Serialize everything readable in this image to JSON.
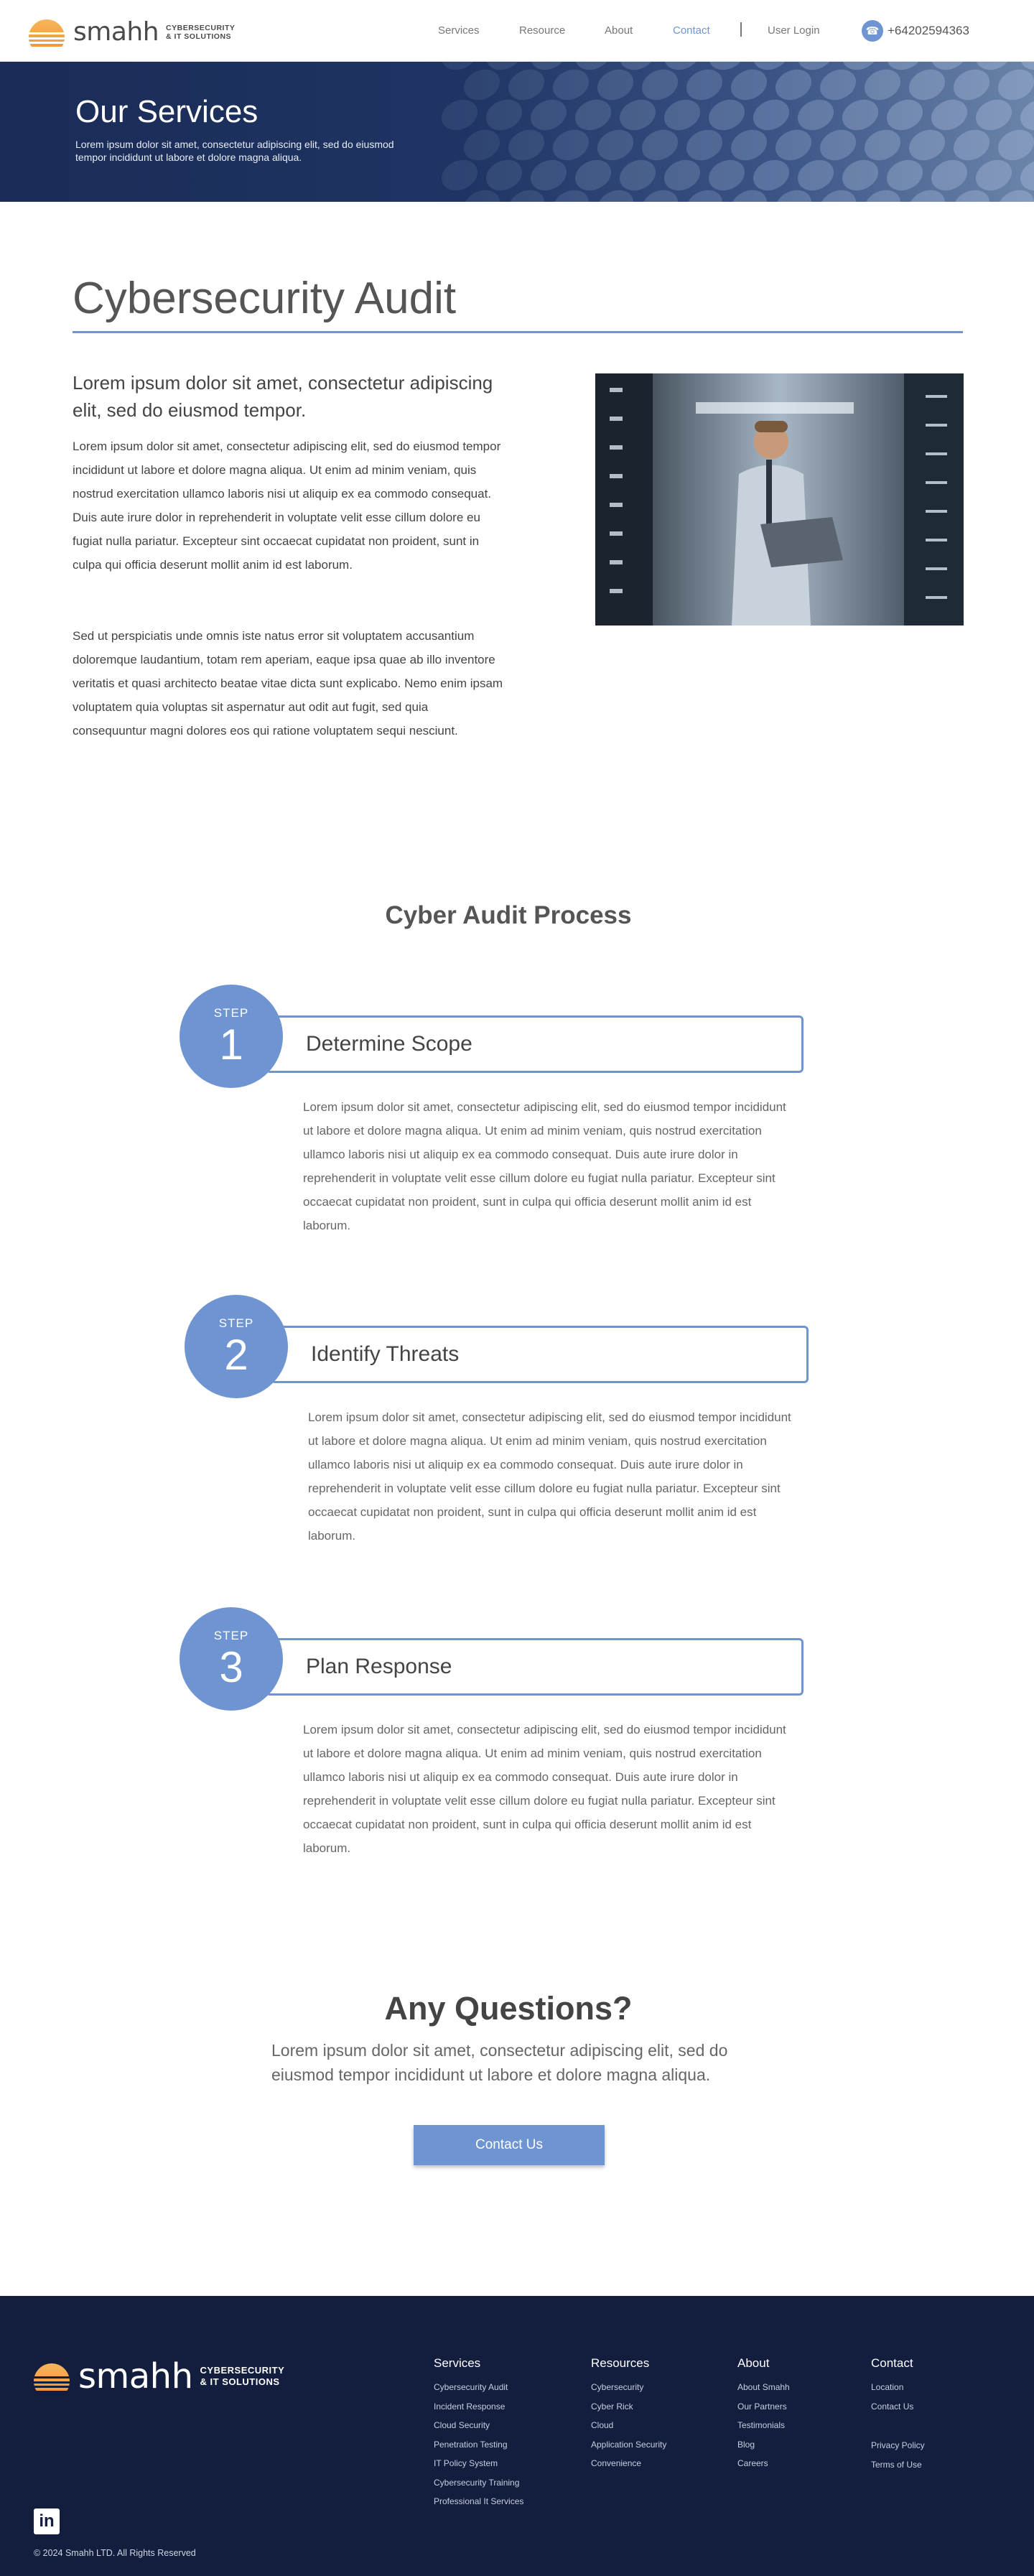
{
  "brand": {
    "name": "smahh",
    "tagline_1": "CYBERSECURITY",
    "tagline_2": "& IT SOLUTIONS"
  },
  "nav": {
    "links": [
      "Services",
      "Resource",
      "About",
      "Contact"
    ],
    "active": "Contact",
    "login": "User Login",
    "phone": "+64202594363"
  },
  "hero": {
    "title": "Our Services",
    "subtitle": "Lorem ipsum dolor sit amet, consectetur adipiscing elit, sed do eiusmod tempor incididunt ut labore et dolore magna aliqua."
  },
  "audit": {
    "title": "Cybersecurity Audit",
    "lead": "Lorem ipsum dolor sit amet, consectetur adipiscing elit, sed do eiusmod tempor.",
    "para1": "Lorem ipsum dolor sit amet, consectetur adipiscing elit, sed do eiusmod tempor incididunt ut labore et dolore magna aliqua. Ut enim ad minim veniam, quis nostrud exercitation ullamco laboris nisi ut aliquip ex ea commodo consequat. Duis aute irure dolor in reprehenderit in voluptate velit esse cillum dolore eu fugiat nulla pariatur. Excepteur sint occaecat cupidatat non proident, sunt in culpa qui officia deserunt mollit anim id est laborum.",
    "para2": "Sed ut perspiciatis unde omnis iste natus error sit voluptatem accusantium doloremque laudantium, totam rem aperiam, eaque ipsa quae ab illo inventore veritatis et quasi architecto beatae vitae dicta sunt explicabo. Nemo enim ipsam voluptatem quia voluptas sit aspernatur aut odit aut fugit, sed quia consequuntur magni dolores eos qui ratione voluptatem sequi nesciunt."
  },
  "process": {
    "title": "Cyber Audit Process",
    "step_label": "STEP",
    "steps": [
      {
        "number": "1",
        "name": "Determine Scope",
        "text": "Lorem ipsum dolor sit amet, consectetur adipiscing elit, sed do eiusmod tempor incididunt ut labore et dolore magna aliqua. Ut enim ad minim veniam, quis nostrud exercitation ullamco laboris nisi ut aliquip ex ea commodo consequat. Duis aute irure dolor in reprehenderit in voluptate velit esse cillum dolore eu fugiat nulla pariatur. Excepteur sint occaecat cupidatat non proident, sunt in culpa qui officia deserunt mollit anim id est laborum."
      },
      {
        "number": "2",
        "name": "Identify Threats",
        "text": "Lorem ipsum dolor sit amet, consectetur adipiscing elit, sed do eiusmod tempor incididunt ut labore et dolore magna aliqua. Ut enim ad minim veniam, quis nostrud exercitation ullamco laboris nisi ut aliquip ex ea commodo consequat. Duis aute irure dolor in reprehenderit in voluptate velit esse cillum dolore eu fugiat nulla pariatur. Excepteur sint occaecat cupidatat non proident, sunt in culpa qui officia deserunt mollit anim id est laborum."
      },
      {
        "number": "3",
        "name": "Plan Response",
        "text": "Lorem ipsum dolor sit amet, consectetur adipiscing elit, sed do eiusmod tempor incididunt ut labore et dolore magna aliqua. Ut enim ad minim veniam, quis nostrud exercitation ullamco laboris nisi ut aliquip ex ea commodo consequat. Duis aute irure dolor in reprehenderit in voluptate velit esse cillum dolore eu fugiat nulla pariatur. Excepteur sint occaecat cupidatat non proident, sunt in culpa qui officia deserunt mollit anim id est laborum."
      }
    ]
  },
  "questions": {
    "title": "Any Questions?",
    "text": "Lorem ipsum dolor sit amet, consectetur adipiscing elit, sed do eiusmod tempor incididunt ut labore et dolore magna aliqua.",
    "button": "Contact Us"
  },
  "footer": {
    "columns": [
      {
        "title": "Services",
        "items": [
          "Cybersecurity Audit",
          "Incident Response",
          "Cloud Security",
          "Penetration Testing",
          "IT Policy System",
          "Cybersecurity Training",
          "Professional It Services"
        ]
      },
      {
        "title": "Resources",
        "items": [
          "Cybersecurity",
          "Cyber Rick",
          "Cloud",
          "Application Security",
          "Convenience"
        ]
      },
      {
        "title": "About",
        "items": [
          "About Smahh",
          "Our Partners",
          "Testimonials",
          "Blog",
          "Careers"
        ]
      },
      {
        "title": "Contact",
        "items": [
          "Location",
          "Contact Us"
        ],
        "items_2": [
          "Privacy Policy",
          "Terms of Use"
        ]
      }
    ],
    "social": "in",
    "copyright": "© 2024 Smahh LTD.  All Rights Reserved"
  },
  "colors": {
    "accent": "#6f94d2",
    "navy": "#131e3f",
    "hero": "#1f3463"
  }
}
